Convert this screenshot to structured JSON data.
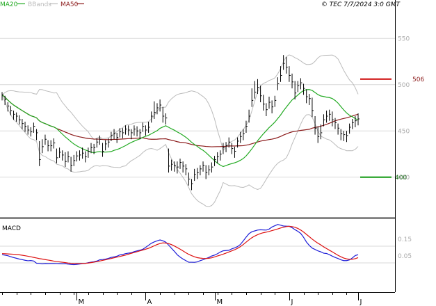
{
  "chart_data": [
    {
      "type": "ohlc",
      "title": "",
      "header_note": "© TEC 7/7/2024 3:0 GMT",
      "legend": [
        {
          "name": "MA20",
          "color": "#22aa22"
        },
        {
          "name": "BBands",
          "color": "#bbbbbb"
        },
        {
          "name": "MA50",
          "color": "#8b1a1a"
        }
      ],
      "ylim": [
        360,
        575
      ],
      "y_ticks": [
        400,
        450,
        500,
        550
      ],
      "y_tick_labels": [
        "400",
        "450",
        "500",
        "550"
      ],
      "x_month_labels": [
        {
          "index": 26,
          "label": "M"
        },
        {
          "index": 50,
          "label": "A"
        },
        {
          "index": 74,
          "label": "M"
        },
        {
          "index": 100,
          "label": "J"
        },
        {
          "index": 124,
          "label": "J"
        }
      ],
      "close": [
        489,
        484,
        477,
        472,
        468,
        466,
        462,
        458,
        455,
        451,
        449,
        455,
        448,
        419,
        433,
        441,
        434,
        434,
        437,
        421,
        427,
        424,
        417,
        422,
        413,
        418,
        423,
        424,
        426,
        422,
        428,
        432,
        432,
        438,
        441,
        428,
        436,
        438,
        445,
        447,
        443,
        449,
        448,
        452,
        451,
        448,
        452,
        450,
        448,
        455,
        451,
        454,
        466,
        470,
        475,
        478,
        466,
        464,
        412,
        414,
        413,
        411,
        416,
        412,
        409,
        398,
        393,
        403,
        405,
        409,
        413,
        405,
        408,
        411,
        419,
        422,
        425,
        432,
        434,
        438,
        431,
        428,
        439,
        444,
        447,
        455,
        466,
        483,
        492,
        497,
        488,
        479,
        473,
        481,
        476,
        483,
        501,
        510,
        523,
        519,
        510,
        503,
        491,
        499,
        502,
        496,
        487,
        485,
        472,
        453,
        444,
        448,
        462,
        466,
        468,
        462,
        459,
        453,
        447,
        446,
        445,
        454,
        459,
        461,
        463
      ],
      "high": [
        492,
        488,
        481,
        477,
        472,
        470,
        467,
        463,
        460,
        456,
        454,
        459,
        452,
        439,
        441,
        446,
        440,
        440,
        442,
        431,
        432,
        429,
        427,
        428,
        422,
        424,
        428,
        429,
        432,
        428,
        432,
        437,
        436,
        442,
        445,
        437,
        440,
        442,
        449,
        452,
        448,
        453,
        453,
        456,
        456,
        452,
        456,
        455,
        452,
        459,
        456,
        460,
        471,
        482,
        480,
        484,
        476,
        469,
        431,
        419,
        417,
        417,
        420,
        417,
        414,
        405,
        398,
        409,
        410,
        413,
        417,
        413,
        413,
        416,
        423,
        427,
        429,
        437,
        438,
        443,
        437,
        433,
        443,
        449,
        452,
        461,
        473,
        496,
        504,
        506,
        499,
        489,
        480,
        487,
        483,
        488,
        508,
        520,
        532,
        530,
        520,
        512,
        504,
        504,
        507,
        501,
        495,
        490,
        486,
        466,
        455,
        457,
        468,
        472,
        473,
        471,
        464,
        458,
        452,
        450,
        450,
        458,
        463,
        466,
        469
      ],
      "low": [
        483,
        478,
        471,
        467,
        462,
        460,
        457,
        452,
        449,
        446,
        444,
        448,
        440,
        412,
        426,
        435,
        428,
        428,
        431,
        415,
        421,
        418,
        411,
        416,
        406,
        412,
        417,
        418,
        420,
        416,
        421,
        426,
        425,
        432,
        435,
        422,
        429,
        432,
        439,
        441,
        437,
        443,
        442,
        446,
        445,
        441,
        445,
        444,
        441,
        449,
        445,
        448,
        459,
        463,
        468,
        471,
        459,
        457,
        405,
        407,
        406,
        404,
        409,
        405,
        402,
        391,
        386,
        396,
        398,
        402,
        406,
        398,
        402,
        405,
        412,
        415,
        418,
        425,
        427,
        432,
        425,
        421,
        432,
        437,
        440,
        448,
        459,
        476,
        485,
        490,
        481,
        472,
        466,
        474,
        469,
        476,
        494,
        503,
        516,
        512,
        503,
        496,
        484,
        492,
        495,
        489,
        480,
        478,
        465,
        446,
        437,
        441,
        455,
        459,
        461,
        455,
        452,
        446,
        440,
        439,
        438,
        447,
        452,
        454,
        456
      ]
    },
    {
      "type": "line",
      "title": "MACD",
      "ylim": [
        -27,
        24
      ],
      "y_ticks": [
        0.05,
        0.15
      ],
      "y_tick_labels": [
        "0.05",
        "0.15"
      ],
      "series": [
        {
          "name": "",
          "color": "#1f1fd8",
          "values": [
            -0.1,
            -0.46,
            -0.84,
            -1.57,
            -2.15,
            -2.68,
            -3.25,
            -3.67,
            -4.13,
            -4.47,
            -4.3,
            -4.64,
            -6.25,
            -6.35,
            -6.67,
            -6.43,
            -6.49,
            -6.44,
            -6.45,
            -6.47,
            -6.56,
            -6.67,
            -6.58,
            -6.92,
            -7.11,
            -7.26,
            -7.06,
            -6.84,
            -6.52,
            -6.4,
            -5.85,
            -5.51,
            -5.17,
            -4.69,
            -3.78,
            -3.6,
            -3.29,
            -2.8,
            -2.07,
            -1.7,
            -1.19,
            -0.31,
            0.06,
            0.64,
            1.0,
            1.32,
            2.07,
            2.65,
            3.12,
            3.79,
            5.14,
            6.65,
            8.11,
            9.11,
            9.84,
            10.49,
            9.89,
            8.91,
            6.81,
            4.5,
            2.29,
            -0.16,
            -1.81,
            -3.22,
            -4.38,
            -5.54,
            -5.53,
            -5.59,
            -5.3,
            -4.43,
            -3.73,
            -2.89,
            -2.07,
            -1.06,
            -0.39,
            0.57,
            1.8,
            2.69,
            2.88,
            3.05,
            4.07,
            4.78,
            5.71,
            7.26,
            9.82,
            12.5,
            15.0,
            16.4,
            17.0,
            17.6,
            17.8,
            17.7,
            17.6,
            18.3,
            19.8,
            20.7,
            21.6,
            21.1,
            20.5,
            20.4,
            20.3,
            19.3,
            17.9,
            16.7,
            15.2,
            12.4,
            9.01,
            6.54,
            4.65,
            3.67,
            2.63,
            1.94,
            0.98,
            0.76,
            -0.09,
            -1.15,
            -2.11,
            -2.85,
            -3.76,
            -4.38,
            -4.37,
            -3.87,
            -2.45,
            -0.69,
            -0.13
          ]
        },
        {
          "name": "",
          "color": "#dd1111",
          "values": [
            0.65,
            0.57,
            0.42,
            0.31,
            0.22,
            -0.01,
            -0.18,
            -0.51,
            -0.85,
            -1.22,
            -1.6,
            -2.07,
            -2.47,
            -2.94,
            -3.24,
            -3.63,
            -3.98,
            -4.31,
            -4.72,
            -5.08,
            -5.27,
            -5.54,
            -5.79,
            -6.11,
            -6.29,
            -6.42,
            -6.46,
            -6.46,
            -6.36,
            -6.31,
            -6.14,
            -5.82,
            -5.47,
            -5.07,
            -4.67,
            -4.2,
            -3.77,
            -3.29,
            -2.86,
            -2.36,
            -1.86,
            -1.4,
            -0.88,
            -0.4,
            0.23,
            0.88,
            1.46,
            2.02,
            2.65,
            3.25,
            3.86,
            4.5,
            5.36,
            6.32,
            7.23,
            7.92,
            8.37,
            8.26,
            7.86,
            7.15,
            6.16,
            5.02,
            3.86,
            2.62,
            1.29,
            0.14,
            -0.78,
            -1.61,
            -2.25,
            -2.57,
            -2.79,
            -2.84,
            -2.7,
            -2.33,
            -1.73,
            -1.05,
            -0.38,
            0.3,
            1.04,
            1.84,
            2.63,
            3.44,
            4.47,
            5.69,
            7.21,
            8.89,
            10.6,
            12.1,
            13.3,
            14.3,
            15.1,
            15.7,
            16.1,
            16.6,
            17.2,
            17.8,
            18.4,
            19.1,
            19.6,
            20.1,
            20.3,
            20.1,
            19.6,
            18.8,
            17.6,
            16.2,
            14.5,
            12.8,
            11.1,
            9.56,
            8.15,
            6.94,
            5.53,
            4.31,
            3.09,
            1.93,
            0.67,
            -0.58,
            -1.61,
            -2.51,
            -3.12,
            -3.4,
            -3.39,
            -2.96,
            -2.21
          ]
        }
      ]
    }
  ],
  "annotations": [
    {
      "label": "506",
      "value": 506,
      "color": "#cc0000"
    },
    {
      "label": "400",
      "value": 400,
      "color": "#119911"
    }
  ]
}
